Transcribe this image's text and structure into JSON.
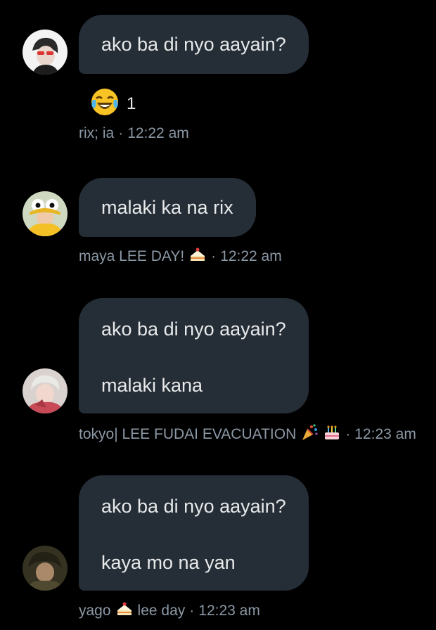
{
  "messages": [
    {
      "lines": [
        "ako ba di nyo aayain?"
      ],
      "reaction": {
        "emoji": "laughing-tears-icon",
        "count": "1"
      },
      "meta": {
        "sender": "rix; ia",
        "time": "12:22 am"
      }
    },
    {
      "lines": [
        "malaki ka na rix"
      ],
      "meta": {
        "sender": "maya LEE DAY!",
        "time": "12:22 am",
        "sender_emoji": "cake-icon"
      }
    },
    {
      "lines": [
        "ako ba di nyo aayain?",
        "malaki kana"
      ],
      "meta": {
        "sender": "tokyo| LEE FUDAI EVACUATION",
        "time": "12:23 am",
        "sender_emoji": "party-popper-birthday-cake-icons"
      }
    },
    {
      "lines": [
        "ako ba di nyo aayain?",
        "kaya mo na yan"
      ],
      "meta": {
        "sender": "yago",
        "sender_suffix": "lee day",
        "time": "12:23 am",
        "sender_emoji": "cake-icon"
      }
    }
  ],
  "separator": "·",
  "colors": {
    "background": "#000000",
    "bubble": "#252d36",
    "text": "#e7e9ea",
    "meta": "#8b98a5"
  }
}
